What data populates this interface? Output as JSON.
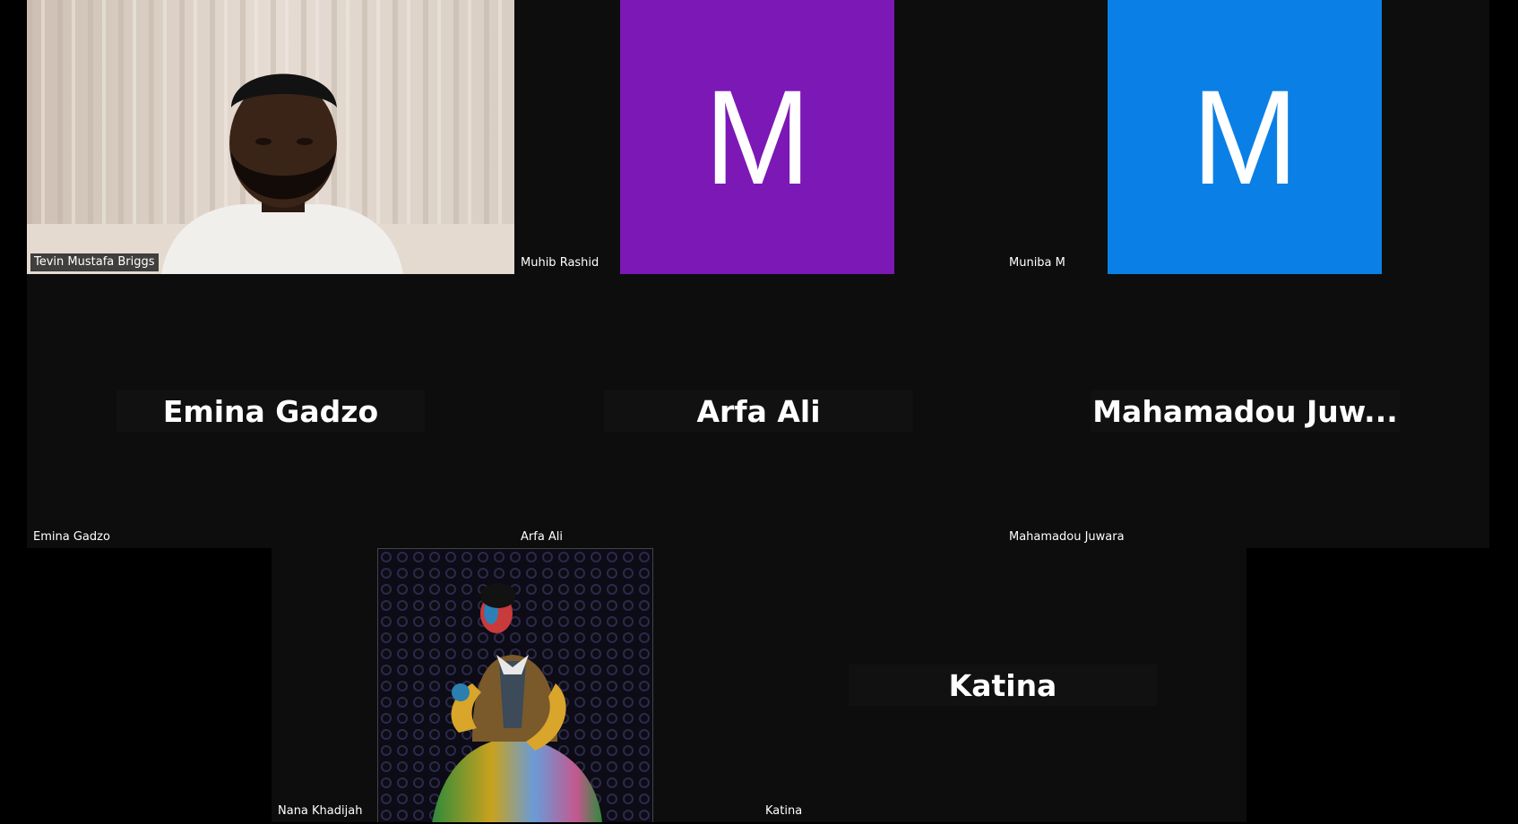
{
  "meeting": {
    "participants": [
      {
        "id": "tevin",
        "name": "Tevin Mustafa Briggs",
        "display": "video"
      },
      {
        "id": "muhib",
        "name": "Muhib Rashid",
        "display": "avatar",
        "avatar_letter": "M",
        "avatar_color": "#7b18b6"
      },
      {
        "id": "muniba",
        "name": "Muniba M",
        "display": "avatar",
        "avatar_letter": "M",
        "avatar_color": "#0a80e6"
      },
      {
        "id": "emina",
        "name": "Emina Gadzo",
        "display": "name",
        "plate": "Emina Gadzo"
      },
      {
        "id": "arfa",
        "name": "Arfa Ali",
        "display": "name",
        "plate": "Arfa Ali"
      },
      {
        "id": "mahamadou",
        "name": "Mahamadou Juwara",
        "display": "name",
        "plate": "Mahamadou  Juw..."
      },
      {
        "id": "nana",
        "name": "Nana Khadijah",
        "display": "image"
      },
      {
        "id": "katina",
        "name": "Katina",
        "display": "name",
        "plate": "Katina"
      }
    ]
  }
}
